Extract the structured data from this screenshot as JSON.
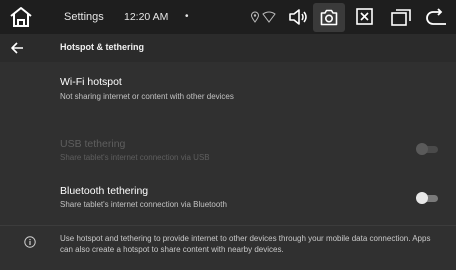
{
  "statusbar": {
    "title": "Settings",
    "time": "12:20 AM",
    "dot": "•",
    "icons": [
      "home-icon",
      "location-icon",
      "wifi-icon",
      "volume-icon",
      "screenshot-icon",
      "close-box-icon",
      "windows-icon",
      "back-icon"
    ]
  },
  "appbar": {
    "back_icon": "arrow-left-icon",
    "title": "Hotspot & tethering"
  },
  "rows": [
    {
      "title": "Wi-Fi hotspot",
      "subtitle": "Not sharing internet or content with other devices",
      "enabled": true
    },
    {
      "title": "USB tethering",
      "subtitle": "Share tablet's internet connection via USB",
      "enabled": false,
      "toggle_on": false
    },
    {
      "title": "Bluetooth tethering",
      "subtitle": "Share tablet's internet connection via Bluetooth",
      "enabled": true,
      "toggle_on": false
    }
  ],
  "info": {
    "icon": "info-icon",
    "text": "Use hotspot and tethering to provide internet to other devices through your mobile data connection. Apps can also create a hotspot to share content with nearby devices."
  },
  "colors": {
    "background": "#303030",
    "statusbar": "#1e1e1e",
    "disabled_text": "#5e5e5e"
  }
}
